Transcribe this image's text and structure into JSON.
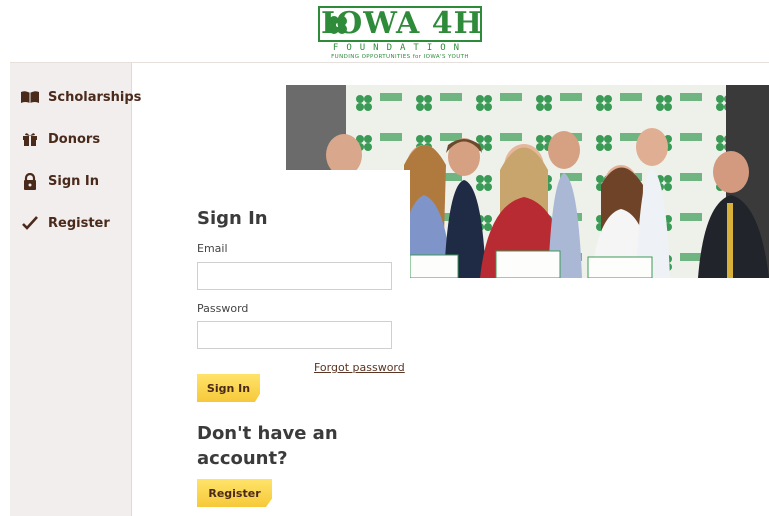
{
  "logo": {
    "main": "IOWA 4H",
    "sub": "FOUNDATION",
    "tagline": "FUNDING OPPORTUNITIES for IOWA'S YOUTH"
  },
  "sidebar": {
    "items": [
      {
        "label": "Scholarships",
        "icon": "book-icon"
      },
      {
        "label": "Donors",
        "icon": "gift-icon"
      },
      {
        "label": "Sign In",
        "icon": "lock-icon"
      },
      {
        "label": "Register",
        "icon": "check-icon"
      }
    ]
  },
  "signin": {
    "title": "Sign In",
    "email_label": "Email",
    "email_value": "",
    "password_label": "Password",
    "password_value": "",
    "forgot_label": "Forgot password",
    "button_label": "Sign In"
  },
  "register": {
    "title": "Don't have an account?",
    "button_label": "Register"
  },
  "colors": {
    "brand_green": "#2e8b3a",
    "brown": "#4a2a1b",
    "button_yellow": "#f6c93a",
    "sidebar_bg": "#f1eeed"
  }
}
